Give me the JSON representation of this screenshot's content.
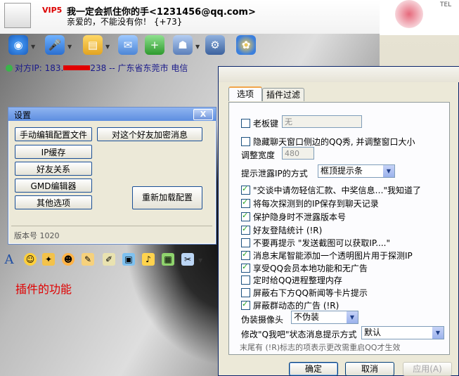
{
  "chat": {
    "vip_badge": "VIP5",
    "nickname": "我一定会抓住你的手<1231456@qq.com>",
    "signature": "亲爱的，不能没有你！   {+73}",
    "peer_ip_prefix": "对方IP: 183.",
    "peer_ip_suffix": "238 -- 广东省东莞市 电信",
    "plugin_label": "插件的功能",
    "right_text": "TEL"
  },
  "settings": {
    "title": "设置",
    "close_label": "X",
    "buttons": {
      "manual_edit": "手动编辑配置文件",
      "encrypt": "对这个好友加密消息",
      "ip_cache": "IP缓存",
      "relations": "好友关系",
      "gmd_editor": "GMD编辑器",
      "other": "其他选项",
      "reload": "重新加载配置"
    },
    "version_label": "版本号",
    "version_value": "1020"
  },
  "plugin_window": {
    "tabs": [
      "选项",
      "插件过滤"
    ],
    "boss_key_label": "老板键",
    "boss_key_value": "无",
    "hide_qqshow_label": "隐藏聊天窗口侧边的QQ秀, 并调整窗口大小",
    "adjust_width_label": "调整宽度",
    "adjust_width_value": "480",
    "ip_leak_label": "提示泄露IP的方式",
    "ip_leak_value": "框顶提示条",
    "options": [
      {
        "label": "\"交谈中请勿轻信汇款、中奖信息…\"我知道了",
        "checked": true
      },
      {
        "label": "将每次探测到的IP保存到聊天记录",
        "checked": true
      },
      {
        "label": "保护隐身时不泄露版本号",
        "checked": true
      },
      {
        "label": "好友登陆统计 (!R)",
        "checked": true
      },
      {
        "label": "不要再提示 \"发送截图可以获取IP....\"",
        "checked": false
      },
      {
        "label": "消息末尾智能添加一个透明图片用于探测IP",
        "checked": true
      },
      {
        "label": "享受QQ会员本地功能和无广告",
        "checked": true
      },
      {
        "label": "定时给QQ进程整理内存",
        "checked": false
      },
      {
        "label": "屏蔽右下方QQ新闻等卡片提示",
        "checked": false
      },
      {
        "label": "屏蔽群动态的广告 (!R)",
        "checked": true
      }
    ],
    "fake_camera_label": "伪装摄像头",
    "fake_camera_value": "不伪装",
    "status_prompt_label": "修改\"Q我吧\"状态消息提示方式",
    "status_prompt_value": "默认",
    "note": "末尾有 (!R)标志的项表示更改需重启QQ才生效",
    "ok_label": "确定",
    "cancel_label": "取消",
    "apply_label": "应用(A)"
  }
}
